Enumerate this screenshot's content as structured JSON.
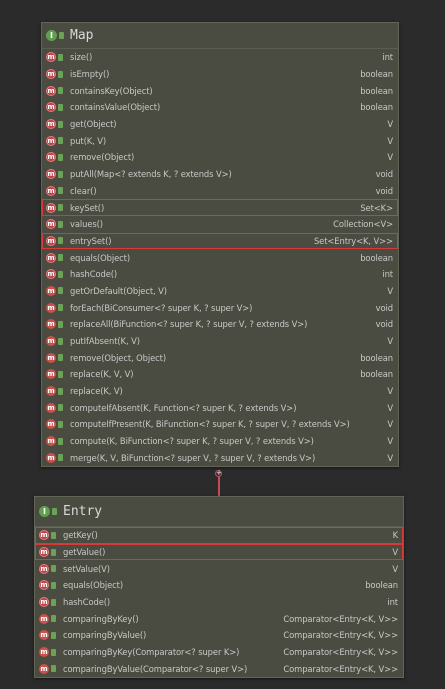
{
  "map": {
    "title": "Map",
    "methods": [
      {
        "sig": "size()",
        "ret": "int",
        "kind": "abstract"
      },
      {
        "sig": "isEmpty()",
        "ret": "boolean",
        "kind": "abstract"
      },
      {
        "sig": "containsKey(Object)",
        "ret": "boolean",
        "kind": "abstract"
      },
      {
        "sig": "containsValue(Object)",
        "ret": "boolean",
        "kind": "abstract"
      },
      {
        "sig": "get(Object)",
        "ret": "V",
        "kind": "abstract"
      },
      {
        "sig": "put(K, V)",
        "ret": "V",
        "kind": "abstract"
      },
      {
        "sig": "remove(Object)",
        "ret": "V",
        "kind": "abstract"
      },
      {
        "sig": "putAll(Map<? extends K, ? extends V>)",
        "ret": "void",
        "kind": "abstract"
      },
      {
        "sig": "clear()",
        "ret": "void",
        "kind": "abstract"
      },
      {
        "sig": "keySet()",
        "ret": "Set<K>",
        "kind": "abstract",
        "highlight": true
      },
      {
        "sig": "values()",
        "ret": "Collection<V>",
        "kind": "abstract"
      },
      {
        "sig": "entrySet()",
        "ret": "Set<Entry<K, V>>",
        "kind": "abstract",
        "highlight": true
      },
      {
        "sig": "equals(Object)",
        "ret": "boolean",
        "kind": "abstract"
      },
      {
        "sig": "hashCode()",
        "ret": "int",
        "kind": "abstract"
      },
      {
        "sig": "getOrDefault(Object, V)",
        "ret": "V",
        "kind": "default"
      },
      {
        "sig": "forEach(BiConsumer<? super K, ? super V>)",
        "ret": "void",
        "kind": "default"
      },
      {
        "sig": "replaceAll(BiFunction<? super K, ? super V, ? extends V>)",
        "ret": "void",
        "kind": "default"
      },
      {
        "sig": "putIfAbsent(K, V)",
        "ret": "V",
        "kind": "default"
      },
      {
        "sig": "remove(Object, Object)",
        "ret": "boolean",
        "kind": "default"
      },
      {
        "sig": "replace(K, V, V)",
        "ret": "boolean",
        "kind": "default"
      },
      {
        "sig": "replace(K, V)",
        "ret": "V",
        "kind": "default"
      },
      {
        "sig": "computeIfAbsent(K, Function<? super K, ? extends V>)",
        "ret": "V",
        "kind": "default"
      },
      {
        "sig": "computeIfPresent(K, BiFunction<? super K, ? super V, ? extends V>)",
        "ret": "V",
        "kind": "default"
      },
      {
        "sig": "compute(K, BiFunction<? super K, ? super V, ? extends V>)",
        "ret": "V",
        "kind": "default"
      },
      {
        "sig": "merge(K, V, BiFunction<? super V, ? super V, ? extends V>)",
        "ret": "V",
        "kind": "default"
      }
    ]
  },
  "entry": {
    "title": "Entry",
    "methods": [
      {
        "sig": "getKey()",
        "ret": "K",
        "kind": "abstract",
        "highlight": true
      },
      {
        "sig": "getValue()",
        "ret": "V",
        "kind": "abstract",
        "highlight": true
      },
      {
        "sig": "setValue(V)",
        "ret": "V",
        "kind": "abstract"
      },
      {
        "sig": "equals(Object)",
        "ret": "boolean",
        "kind": "abstract"
      },
      {
        "sig": "hashCode()",
        "ret": "int",
        "kind": "abstract"
      },
      {
        "sig": "comparingByKey()",
        "ret": "Comparator<Entry<K, V>>",
        "kind": "static"
      },
      {
        "sig": "comparingByValue()",
        "ret": "Comparator<Entry<K, V>>",
        "kind": "static"
      },
      {
        "sig": "comparingByKey(Comparator<? super K>)",
        "ret": "Comparator<Entry<K, V>>",
        "kind": "static"
      },
      {
        "sig": "comparingByValue(Comparator<? super V>)",
        "ret": "Comparator<Entry<K, V>>",
        "kind": "static"
      }
    ]
  },
  "icons": {
    "interface": "interface-icon",
    "method": "method-icon",
    "public": "public-lock-icon"
  },
  "colors": {
    "background": "#2b2b2b",
    "node": "#4b4c41",
    "highlight": "#d83a3a",
    "method_icon": "#c94d4d",
    "interface_icon": "#5fa04e",
    "connector": "#c54b58"
  }
}
